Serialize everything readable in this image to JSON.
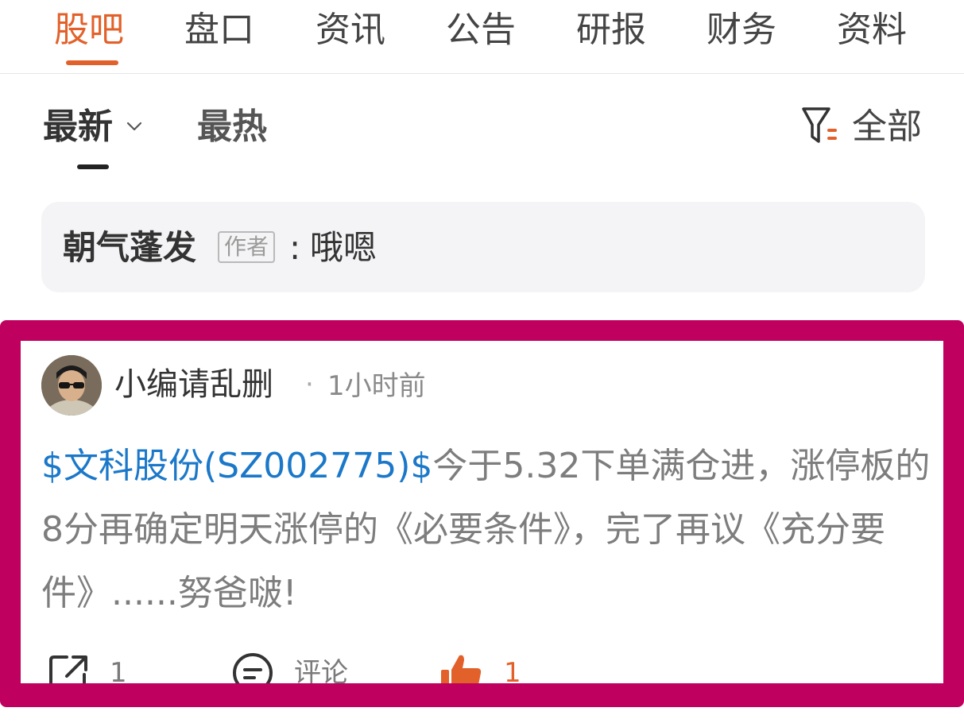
{
  "top_tabs": [
    {
      "label": "股吧",
      "active": true
    },
    {
      "label": "盘口"
    },
    {
      "label": "资讯"
    },
    {
      "label": "公告"
    },
    {
      "label": "研报"
    },
    {
      "label": "财务"
    },
    {
      "label": "资料"
    }
  ],
  "sub_tabs": [
    {
      "label": "最新",
      "active": true,
      "icon": "chevron-down-icon"
    },
    {
      "label": "最热"
    }
  ],
  "filter": {
    "icon": "filter-icon",
    "label": "全部"
  },
  "pinned_note": {
    "author": "朝气蓬发",
    "badge": "作者",
    "colon": ":",
    "message": "哦嗯"
  },
  "post": {
    "username": "小编请乱删",
    "separator": "·",
    "time": "1小时前",
    "stock_link": "$文科股份(SZ002775)$",
    "text": "今于5.32下单满仓进，涨停板的8分再确定明天涨停的《必要条件》，完了再议《充分要件》......努爸啵!",
    "actions": {
      "share_count": "1",
      "comment_label": "评论",
      "like_count": "1"
    }
  },
  "colors": {
    "accent": "#e2612a",
    "link": "#1b78c9",
    "highlight_frame": "#c0005f"
  }
}
